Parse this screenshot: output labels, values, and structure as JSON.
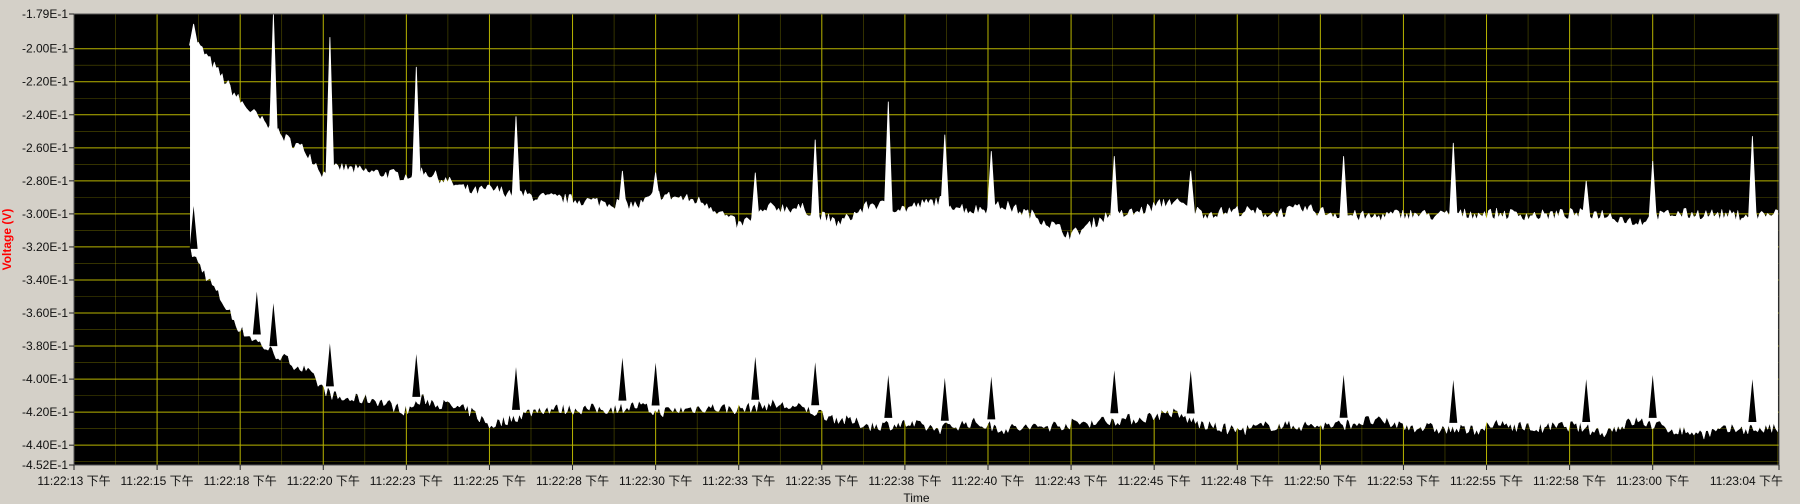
{
  "chart_data": {
    "type": "area",
    "xlabel": "Time",
    "ylabel": "Voltage (V)",
    "ylim": [
      -0.452,
      -0.179
    ],
    "grid": true,
    "colors": {
      "background": "#000000",
      "grid": "#b8b400",
      "trace": "#ffffff",
      "ylabel": "#ff0000",
      "frame": "#d4d0c8"
    },
    "x_ticks": [
      "11:22:13 下午",
      "11:22:15 下午",
      "11:22:18 下午",
      "11:22:20 下午",
      "11:22:23 下午",
      "11:22:25 下午",
      "11:22:28 下午",
      "11:22:30 下午",
      "11:22:33 下午",
      "11:22:35 下午",
      "11:22:38 下午",
      "11:22:40 下午",
      "11:22:43 下午",
      "11:22:45 下午",
      "11:22:48 下午",
      "11:22:50 下午",
      "11:22:53 下午",
      "11:22:55 下午",
      "11:22:58 下午",
      "11:23:00 下午",
      "11:23:04 下午"
    ],
    "x_tick_seconds": [
      0,
      2.5,
      5,
      7.5,
      10,
      12.5,
      15,
      17.5,
      20,
      22.5,
      25,
      27.5,
      30,
      32.5,
      35,
      37.5,
      40,
      42.5,
      45,
      47.5,
      51.3
    ],
    "y_ticks": [
      {
        "value": -0.179,
        "label": "-1.79E-1"
      },
      {
        "value": -0.2,
        "label": "-2.00E-1"
      },
      {
        "value": -0.22,
        "label": "-2.20E-1"
      },
      {
        "value": -0.24,
        "label": "-2.40E-1"
      },
      {
        "value": -0.26,
        "label": "-2.60E-1"
      },
      {
        "value": -0.28,
        "label": "-2.80E-1"
      },
      {
        "value": -0.3,
        "label": "-3.00E-1"
      },
      {
        "value": -0.32,
        "label": "-3.20E-1"
      },
      {
        "value": -0.34,
        "label": "-3.40E-1"
      },
      {
        "value": -0.36,
        "label": "-3.60E-1"
      },
      {
        "value": -0.38,
        "label": "-3.80E-1"
      },
      {
        "value": -0.4,
        "label": "-4.00E-1"
      },
      {
        "value": -0.42,
        "label": "-4.20E-1"
      },
      {
        "value": -0.44,
        "label": "-4.40E-1"
      },
      {
        "value": -0.452,
        "label": "-4.52E-1"
      }
    ],
    "series": [
      {
        "values_seconds": [
          3.5,
          4.0,
          5.0,
          6.0,
          7.0,
          7.5,
          8.0,
          9.0,
          10.0,
          10.5,
          12.0,
          12.5,
          14.0,
          16.0,
          17.0,
          17.5,
          19.0,
          20.0,
          21.0,
          22.0,
          23.0,
          24.0,
          25.0,
          26.0,
          27.0,
          28.0,
          29.0,
          30.0,
          31.0,
          32.0,
          33.0,
          34.0,
          35.0,
          36.0,
          37.0,
          38.0,
          39.0,
          40.0,
          41.0,
          42.0,
          43.0,
          44.0,
          45.0,
          46.0,
          47.0,
          48.0,
          49.0,
          50.0,
          51.3
        ],
        "envelope_upper": [
          -0.191,
          -0.205,
          -0.232,
          -0.25,
          -0.262,
          -0.276,
          -0.272,
          -0.275,
          -0.277,
          -0.274,
          -0.287,
          -0.285,
          -0.29,
          -0.293,
          -0.295,
          -0.288,
          -0.293,
          -0.307,
          -0.296,
          -0.297,
          -0.306,
          -0.294,
          -0.297,
          -0.292,
          -0.298,
          -0.295,
          -0.302,
          -0.313,
          -0.302,
          -0.299,
          -0.292,
          -0.3,
          -0.298,
          -0.3,
          -0.297,
          -0.3,
          -0.302,
          -0.3,
          -0.301,
          -0.3,
          -0.3,
          -0.301,
          -0.3,
          -0.3,
          -0.305,
          -0.3,
          -0.3,
          -0.301,
          -0.3
        ],
        "envelope_lower": [
          -0.322,
          -0.338,
          -0.37,
          -0.384,
          -0.395,
          -0.406,
          -0.412,
          -0.412,
          -0.419,
          -0.412,
          -0.42,
          -0.428,
          -0.418,
          -0.418,
          -0.416,
          -0.42,
          -0.417,
          -0.418,
          -0.415,
          -0.418,
          -0.424,
          -0.428,
          -0.427,
          -0.43,
          -0.426,
          -0.43,
          -0.429,
          -0.427,
          -0.425,
          -0.424,
          -0.42,
          -0.428,
          -0.431,
          -0.428,
          -0.428,
          -0.428,
          -0.425,
          -0.428,
          -0.43,
          -0.431,
          -0.427,
          -0.43,
          -0.428,
          -0.432,
          -0.425,
          -0.43,
          -0.433,
          -0.43,
          -0.43
        ],
        "spikes": [
          {
            "t": 3.6,
            "top": -0.185
          },
          {
            "t": 5.5,
            "top": -0.243
          },
          {
            "t": 6.0,
            "top": -0.179
          },
          {
            "t": 7.7,
            "top": -0.193
          },
          {
            "t": 10.3,
            "top": -0.211
          },
          {
            "t": 13.3,
            "top": -0.241
          },
          {
            "t": 16.5,
            "top": -0.274
          },
          {
            "t": 17.5,
            "top": -0.275
          },
          {
            "t": 20.5,
            "top": -0.275
          },
          {
            "t": 22.3,
            "top": -0.255
          },
          {
            "t": 24.5,
            "top": -0.232
          },
          {
            "t": 26.2,
            "top": -0.252
          },
          {
            "t": 27.6,
            "top": -0.262
          },
          {
            "t": 31.3,
            "top": -0.265
          },
          {
            "t": 33.6,
            "top": -0.274
          },
          {
            "t": 38.2,
            "top": -0.265
          },
          {
            "t": 41.5,
            "top": -0.257
          },
          {
            "t": 45.5,
            "top": -0.28
          },
          {
            "t": 47.5,
            "top": -0.268
          },
          {
            "t": 50.5,
            "top": -0.253
          }
        ]
      }
    ]
  }
}
